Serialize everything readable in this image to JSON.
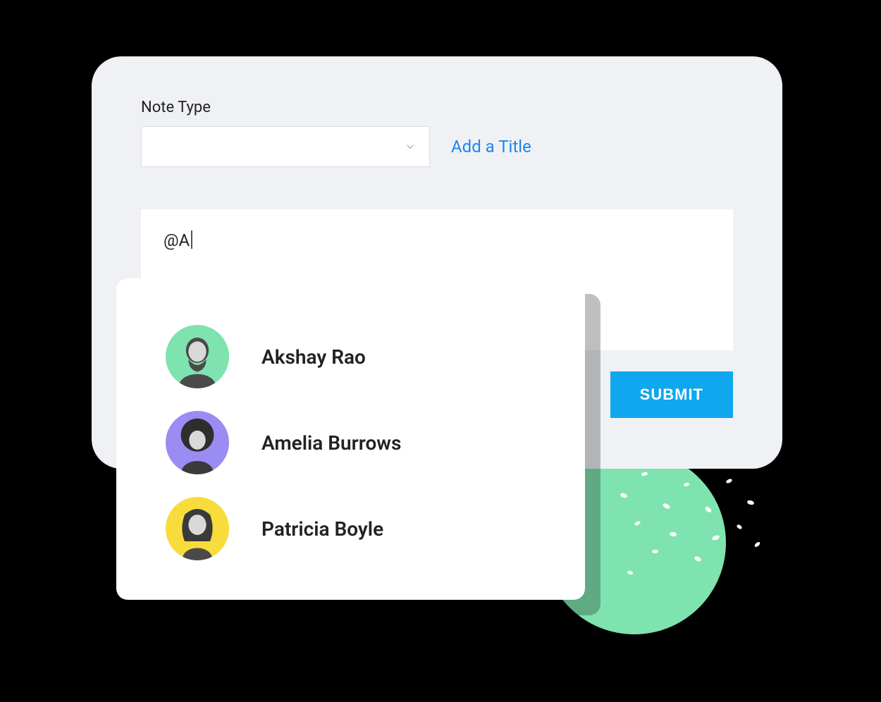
{
  "form": {
    "note_type_label": "Note Type",
    "add_title_link": "Add a Title",
    "textarea_value": "@A",
    "submit_label": "SUBMIT"
  },
  "mentions": {
    "items": [
      {
        "name": "Akshay Rao",
        "avatar_bg": "#7FE3AF"
      },
      {
        "name": "Amelia Burrows",
        "avatar_bg": "#9A8CF2"
      },
      {
        "name": "Patricia Boyle",
        "avatar_bg": "#F8DC3C"
      }
    ]
  },
  "colors": {
    "panel_bg": "#EFF1F5",
    "link": "#1F86E8",
    "submit": "#0FA7EE",
    "accent_circle": "#7FE3AF"
  }
}
